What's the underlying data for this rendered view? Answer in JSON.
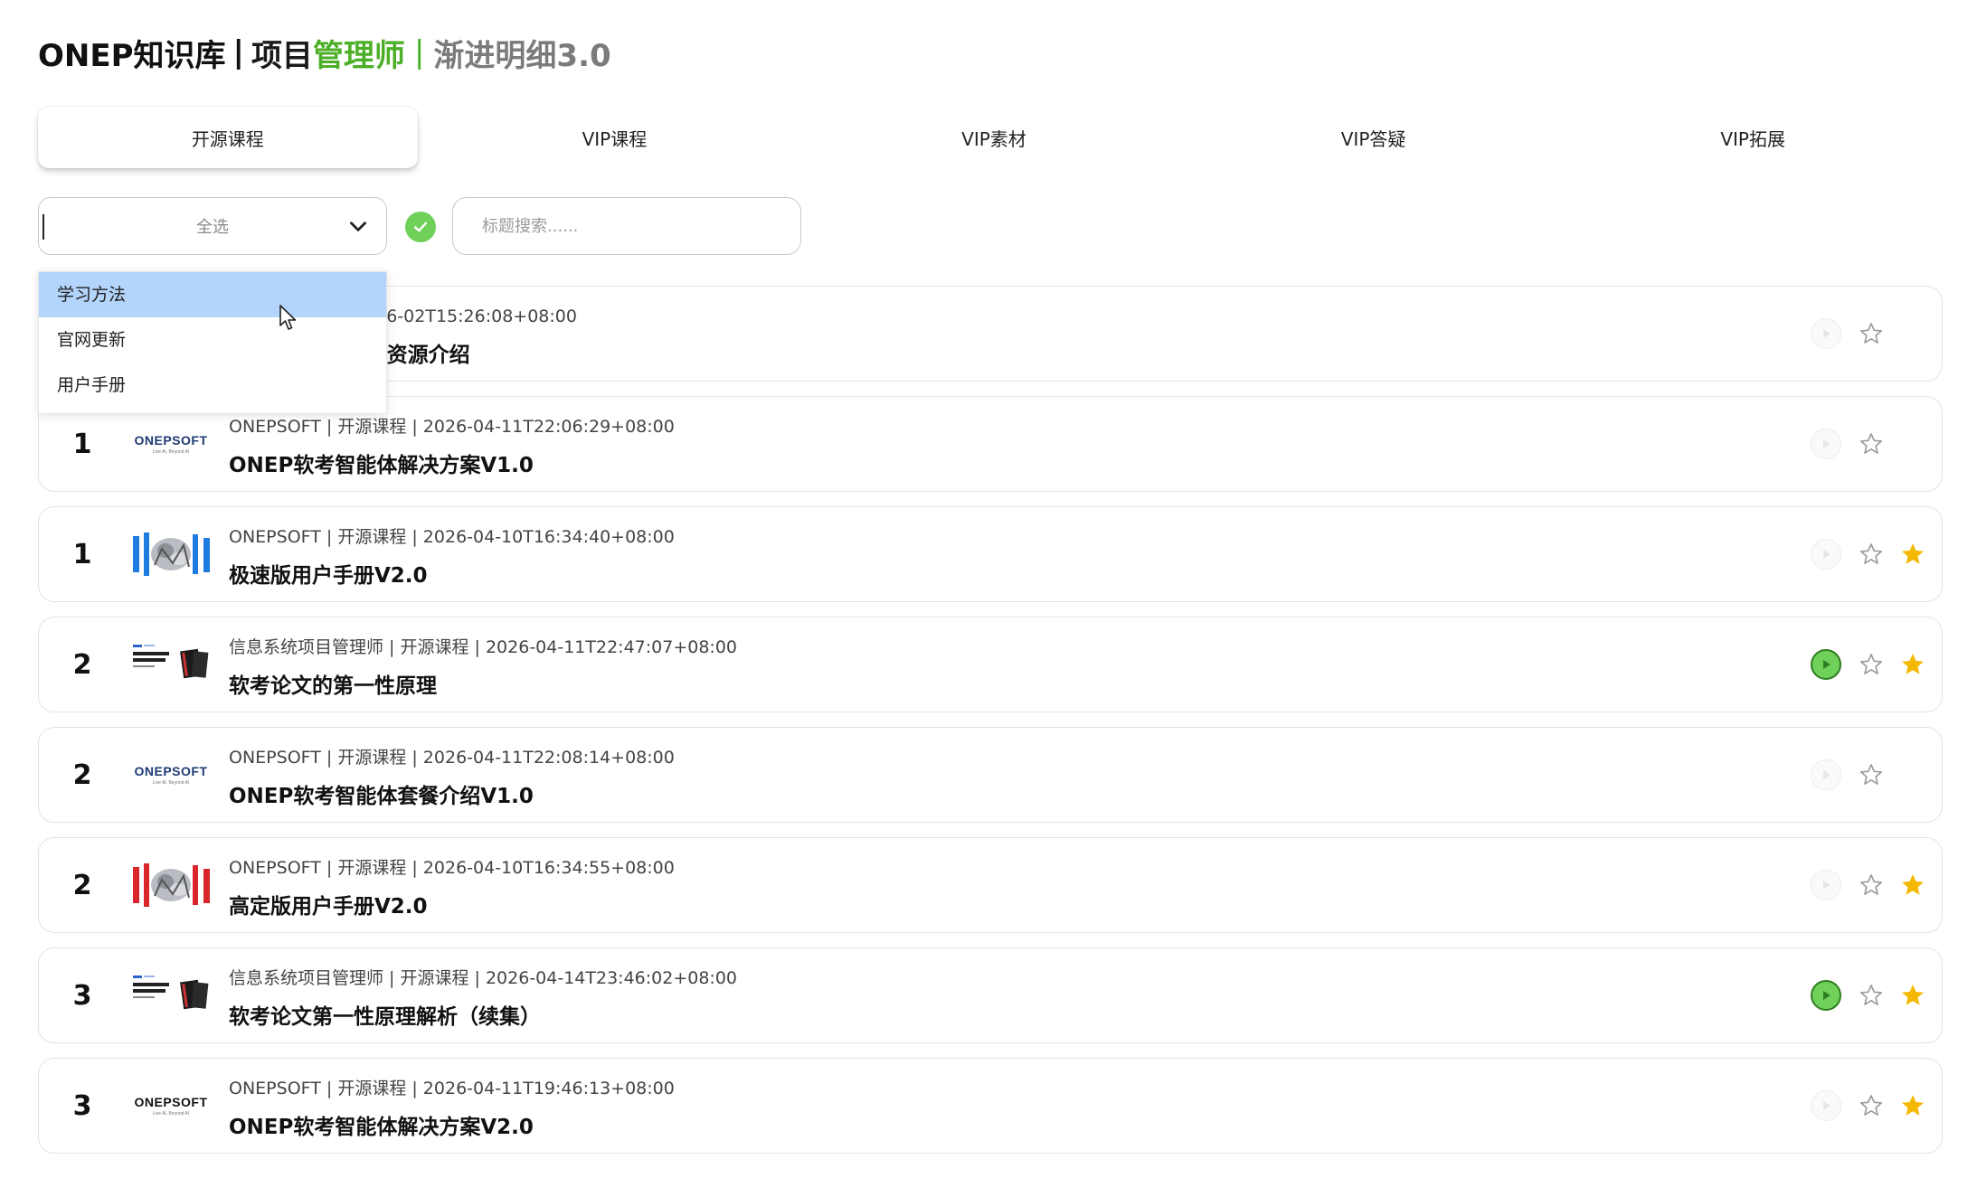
{
  "app_title": {
    "brand": "ONEP知识库",
    "separator": "|",
    "part_dark": "项目",
    "part_green": "管理师",
    "separator2": "|",
    "part_gray": "渐进明细3.0"
  },
  "tabs": [
    {
      "label": "开源课程",
      "active": true
    },
    {
      "label": "VIP课程",
      "active": false
    },
    {
      "label": "VIP素材",
      "active": false
    },
    {
      "label": "VIP答疑",
      "active": false
    },
    {
      "label": "VIP拓展",
      "active": false
    }
  ],
  "filter": {
    "select_value": "全选",
    "search_placeholder": "标题搜索......",
    "options": [
      {
        "label": "学习方法",
        "highlighted": true
      },
      {
        "label": "官网更新",
        "highlighted": false
      },
      {
        "label": "用户手册",
        "highlighted": false
      }
    ]
  },
  "colors": {
    "green_accent": "#4caf27",
    "play_green": "#6fd05a",
    "star_gold": "#f5b800",
    "highlight_blue": "#b3d4fb"
  },
  "items": [
    {
      "num": "",
      "thumb": "hidden",
      "meta": "| 开源课程 | 2026-06-02T15:26:08+08:00",
      "title": "FT 年卡VIP专属资源介绍",
      "play_active": false,
      "favorited": false
    },
    {
      "num": "1",
      "thumb": "logo-blue",
      "logo_text": "ONEPSOFT",
      "logo_sub": "Live AI, Beyond AI",
      "meta": "ONEPSOFT | 开源课程 | 2026-04-11T22:06:29+08:00",
      "title": "ONEP软考智能体解决方案V1.0",
      "play_active": false,
      "favorited": false
    },
    {
      "num": "1",
      "thumb": "robot-blue",
      "meta": "ONEPSOFT | 开源课程 | 2026-04-10T16:34:40+08:00",
      "title": "极速版用户手册V2.0",
      "play_active": false,
      "favorited": true
    },
    {
      "num": "2",
      "thumb": "book",
      "thumb_text": "软考论文的第一性原理",
      "meta": "信息系统项目管理师 | 开源课程 | 2026-04-11T22:47:07+08:00",
      "title": "软考论文的第一性原理",
      "play_active": true,
      "favorited": true
    },
    {
      "num": "2",
      "thumb": "logo-blue",
      "logo_text": "ONEPSOFT",
      "logo_sub": "Live AI, Beyond AI",
      "meta": "ONEPSOFT | 开源课程 | 2026-04-11T22:08:14+08:00",
      "title": "ONEP软考智能体套餐介绍V1.0",
      "play_active": false,
      "favorited": false
    },
    {
      "num": "2",
      "thumb": "robot-red",
      "meta": "ONEPSOFT | 开源课程 | 2026-04-10T16:34:55+08:00",
      "title": "高定版用户手册V2.0",
      "play_active": false,
      "favorited": true
    },
    {
      "num": "3",
      "thumb": "book",
      "thumb_text": "软考论文的第一性原理（续集）",
      "meta": "信息系统项目管理师 | 开源课程 | 2026-04-14T23:46:02+08:00",
      "title": "软考论文第一性原理解析（续集）",
      "play_active": true,
      "favorited": true
    },
    {
      "num": "3",
      "thumb": "logo-dark",
      "logo_text": "ONEPSOFT",
      "logo_sub": "Live AI, Beyond AI",
      "meta": "ONEPSOFT | 开源课程 | 2026-04-11T19:46:13+08:00",
      "title": "ONEP软考智能体解决方案V2.0",
      "play_active": false,
      "favorited": true
    }
  ]
}
